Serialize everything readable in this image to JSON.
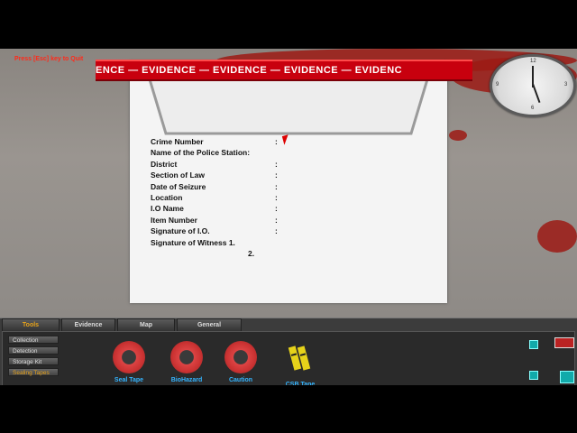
{
  "hud": {
    "quit_text": "Press [Esc] key to Quit"
  },
  "clock": {
    "marks": [
      "12",
      "3",
      "6",
      "9"
    ]
  },
  "tape": {
    "text": "ENCE — EVIDENCE — EVIDENCE — EVIDENCE — EVIDENC"
  },
  "form": {
    "rows": [
      {
        "label": "Crime Number",
        "colon": ":"
      },
      {
        "label": "Name of the Police Station:",
        "colon": ""
      },
      {
        "label": "District",
        "colon": ":"
      },
      {
        "label": "Section of Law",
        "colon": ":"
      },
      {
        "label": "Date of Seizure",
        "colon": ":"
      },
      {
        "label": "Location",
        "colon": ":"
      },
      {
        "label": "I.O Name",
        "colon": ":"
      },
      {
        "label": "Item Number",
        "colon": ":"
      },
      {
        "label": "Signature of I.O.",
        "colon": ":"
      },
      {
        "label": "Signature of Witness 1.",
        "colon": ""
      },
      {
        "label": "2.",
        "colon": ""
      }
    ]
  },
  "panel": {
    "tabs": [
      "Tools",
      "Evidence",
      "Map",
      "General"
    ],
    "side": [
      "Collection",
      "Detection",
      "Storage Kit",
      "Sealing Tapes"
    ],
    "tools": [
      "Seal Tape",
      "BioHazard",
      "Caution",
      "CSB Tape"
    ]
  },
  "colors": {
    "accent": "#e6a21a",
    "tool_label": "#35b5ff",
    "tape": "#c8000e"
  }
}
